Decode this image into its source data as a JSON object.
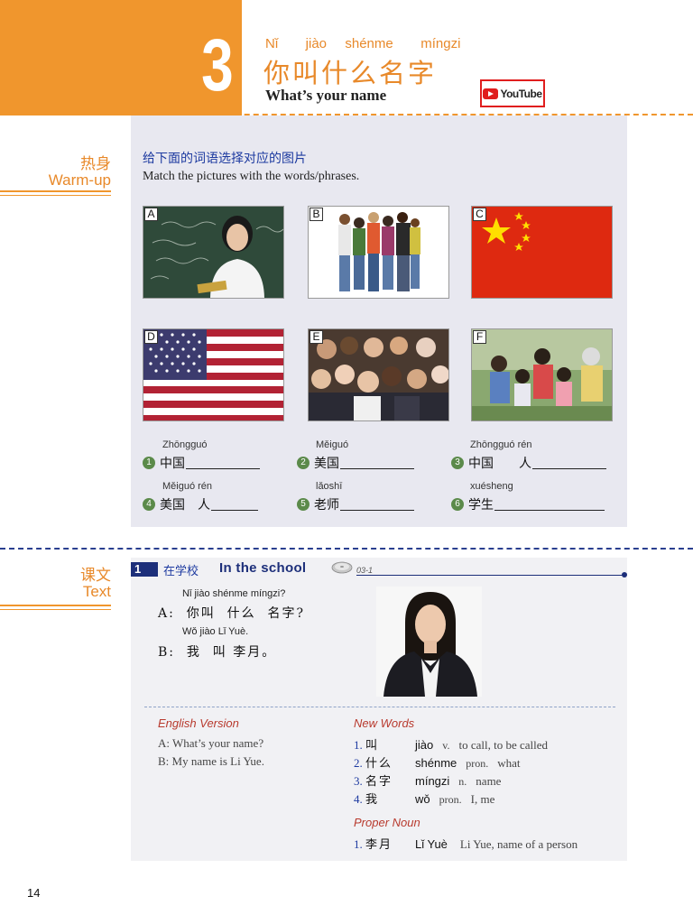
{
  "header": {
    "lesson_number": "3",
    "title_pinyin": "Nǐ   jiào  shénme   míngzi",
    "title_chinese": "你叫什么名字",
    "title_english": "What’s your name",
    "youtube_label": "YouTube"
  },
  "warmup": {
    "side_zh": "热身",
    "side_en": "Warm-up",
    "instruction_zh": "给下面的词语选择对应的图片",
    "instruction_en": "Match the pictures with the words/phrases.",
    "pictures": [
      "A",
      "B",
      "C",
      "D",
      "E",
      "F"
    ],
    "vocab": [
      {
        "num": "1",
        "pinyin": "Zhōngguó",
        "chinese": "中国"
      },
      {
        "num": "2",
        "pinyin": "Měiguó",
        "chinese": "美国"
      },
      {
        "num": "3",
        "pinyin": "Zhōngguó rén",
        "chinese": "中国　　人"
      },
      {
        "num": "4",
        "pinyin": "Měiguó rén",
        "chinese": "美国　人"
      },
      {
        "num": "5",
        "pinyin": "lǎoshī",
        "chinese": "老师"
      },
      {
        "num": "6",
        "pinyin": "xuésheng",
        "chinese": "学生"
      }
    ]
  },
  "text_section": {
    "side_zh": "课文",
    "side_en": "Text",
    "number": "1",
    "title_zh": "在学校",
    "title_en": "In the school",
    "track": "03-1",
    "dialogue": [
      {
        "pinyin": "Nǐ jiào shénme míngzi?",
        "line": "A:  你叫  什么  名字?"
      },
      {
        "pinyin": "Wǒ jiào Lǐ Yuè.",
        "line": "B:  我  叫 李月。"
      }
    ],
    "english_label": "English Version",
    "english_lines": [
      "A: What’s your name?",
      "B: My name is Li Yue."
    ],
    "new_words_label": "New Words",
    "new_words": [
      {
        "num": "1.",
        "zh": "叫",
        "pinyin": "jiào",
        "pos": "v.",
        "def": "to call, to be called"
      },
      {
        "num": "2.",
        "zh": "什么",
        "pinyin": "shénme",
        "pos": "pron.",
        "def": "what"
      },
      {
        "num": "3.",
        "zh": "名字",
        "pinyin": "míngzi",
        "pos": "n.",
        "def": "name"
      },
      {
        "num": "4.",
        "zh": "我",
        "pinyin": "wǒ",
        "pos": "pron.",
        "def": "I, me"
      }
    ],
    "proper_noun_label": "Proper Noun",
    "proper_nouns": [
      {
        "num": "1.",
        "zh": "李月",
        "pinyin": "Lǐ Yuè",
        "def": "Li Yue, name of a person"
      }
    ]
  },
  "page_number": "14",
  "colors": {
    "orange": "#f0962d",
    "navy": "#1d2f7a",
    "blue_text": "#1d3aa0",
    "red_label": "#b83a2e",
    "flag_red": "#de2910"
  }
}
